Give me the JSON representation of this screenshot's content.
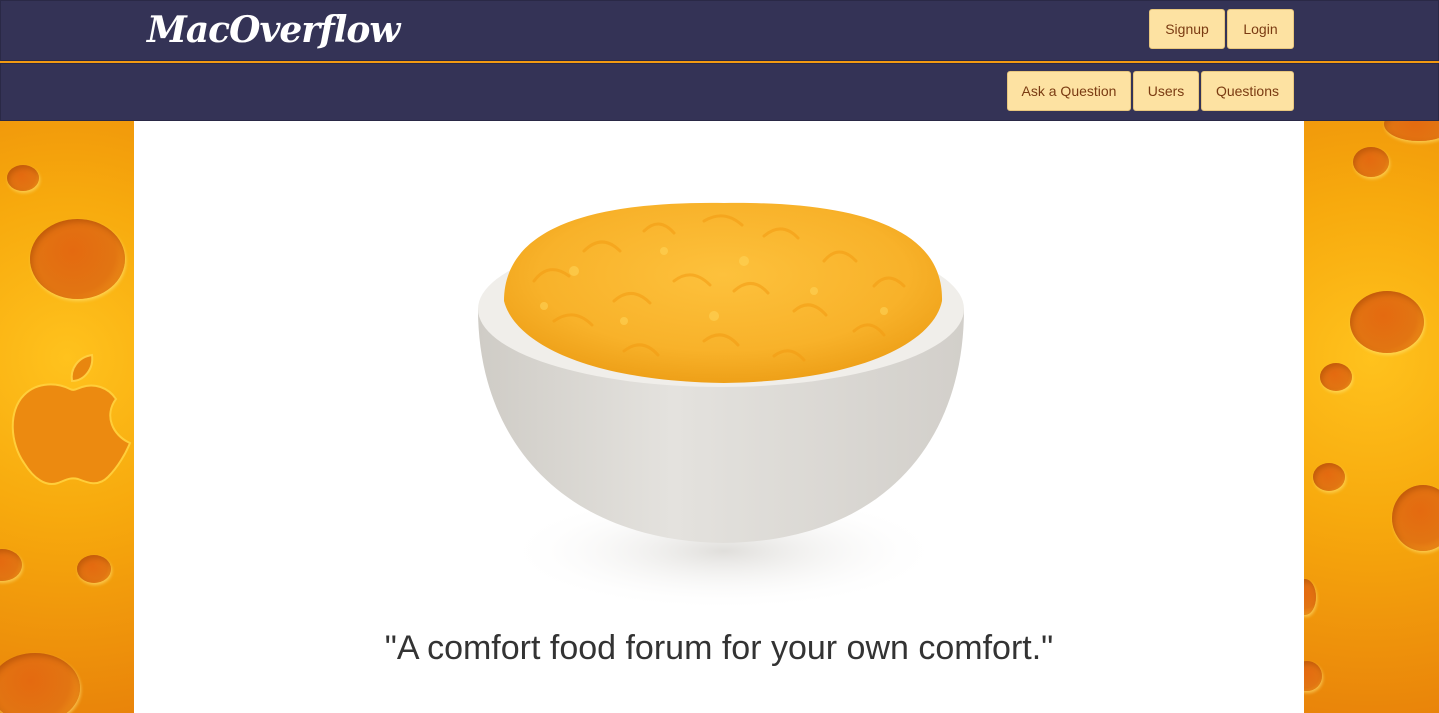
{
  "header": {
    "logo": "MacOverflow",
    "signup_label": "Signup",
    "login_label": "Login"
  },
  "subnav": {
    "ask_label": "Ask a Question",
    "users_label": "Users",
    "questions_label": "Questions"
  },
  "hero": {
    "tagline": "\"A comfort food forum for your own comfort.\""
  },
  "colors": {
    "navbar": "#343356",
    "button": "#fde2a2",
    "button_text": "#7a3b12",
    "cheese": "#f7a90d"
  }
}
